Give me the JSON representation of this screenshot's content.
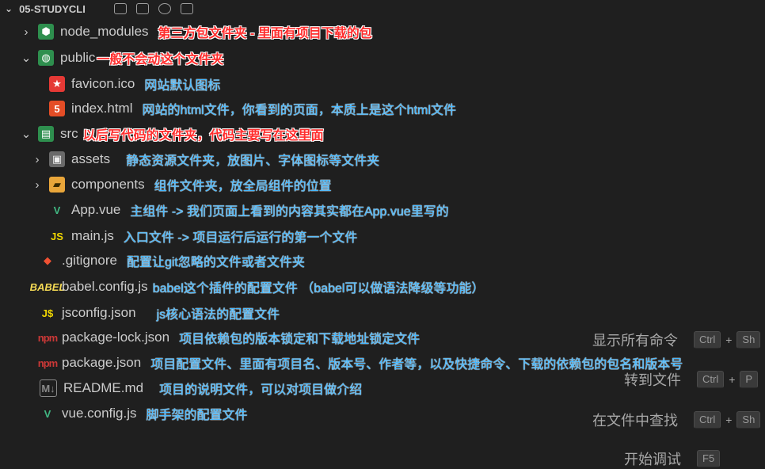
{
  "explorer": {
    "title": "05-STUDYCLI",
    "items": [
      {
        "name": "node_modules",
        "icon": "folder-node-icon",
        "note": "第三方包文件夹 - 里面有项目下载的包",
        "note_style": "red"
      },
      {
        "name": "public",
        "icon": "folder-public-icon",
        "note": "一般不会动这个文件夹",
        "note_style": "red"
      },
      {
        "name": "favicon.ico",
        "icon": "favicon-icon",
        "note": "网站默认图标",
        "note_style": "blue"
      },
      {
        "name": "index.html",
        "icon": "html-icon",
        "note": "网站的html文件，你看到的页面，本质上是这个html文件",
        "note_style": "blue"
      },
      {
        "name": "src",
        "icon": "folder-src-icon",
        "note": "以后写代码的文件夹，代码主要写在这里面",
        "note_style": "red"
      },
      {
        "name": "assets",
        "icon": "folder-assets-icon",
        "note": "静态资源文件夹，放图片、字体图标等文件夹",
        "note_style": "blue"
      },
      {
        "name": "components",
        "icon": "folder-components-icon",
        "note": "组件文件夹，放全局组件的位置",
        "note_style": "blue"
      },
      {
        "name": "App.vue",
        "icon": "vue-icon",
        "note": "主组件 -> 我们页面上看到的内容其实都在App.vue里写的",
        "note_style": "blue"
      },
      {
        "name": "main.js",
        "icon": "js-icon",
        "note": "入口文件 -> 项目运行后运行的第一个文件",
        "note_style": "blue"
      },
      {
        "name": ".gitignore",
        "icon": "git-icon",
        "note": "配置让git忽略的文件或者文件夹",
        "note_style": "blue"
      },
      {
        "name": "babel.config.js",
        "icon": "babel-icon",
        "note": "babel这个插件的配置文件 （babel可以做语法降级等功能）",
        "note_style": "blue"
      },
      {
        "name": "jsconfig.json",
        "icon": "jsconfig-icon",
        "note": "js核心语法的配置文件",
        "note_style": "blue"
      },
      {
        "name": "package-lock.json",
        "icon": "npm-lock-icon",
        "note": "项目依赖包的版本锁定和下载地址锁定文件",
        "note_style": "blue"
      },
      {
        "name": "package.json",
        "icon": "npm-icon",
        "note": "项目配置文件、里面有项目名、版本号、作者等，以及快捷命令、下载的依赖包的包名和版本号",
        "note_style": "blue"
      },
      {
        "name": "README.md",
        "icon": "markdown-icon",
        "note": "项目的说明文件，可以对项目做介绍",
        "note_style": "blue"
      },
      {
        "name": "vue.config.js",
        "icon": "vue-config-icon",
        "note": "脚手架的配置文件",
        "note_style": "blue"
      }
    ]
  },
  "commands": [
    {
      "label": "显示所有命令",
      "keys": [
        "Ctrl",
        "Sh"
      ]
    },
    {
      "label": "转到文件",
      "keys": [
        "Ctrl",
        "P"
      ]
    },
    {
      "label": "在文件中查找",
      "keys": [
        "Ctrl",
        "Sh"
      ]
    },
    {
      "label": "开始调试",
      "keys": [
        "F5"
      ]
    }
  ],
  "glyphs": {
    "chevron_right": "›",
    "chevron_down": "⌄"
  }
}
